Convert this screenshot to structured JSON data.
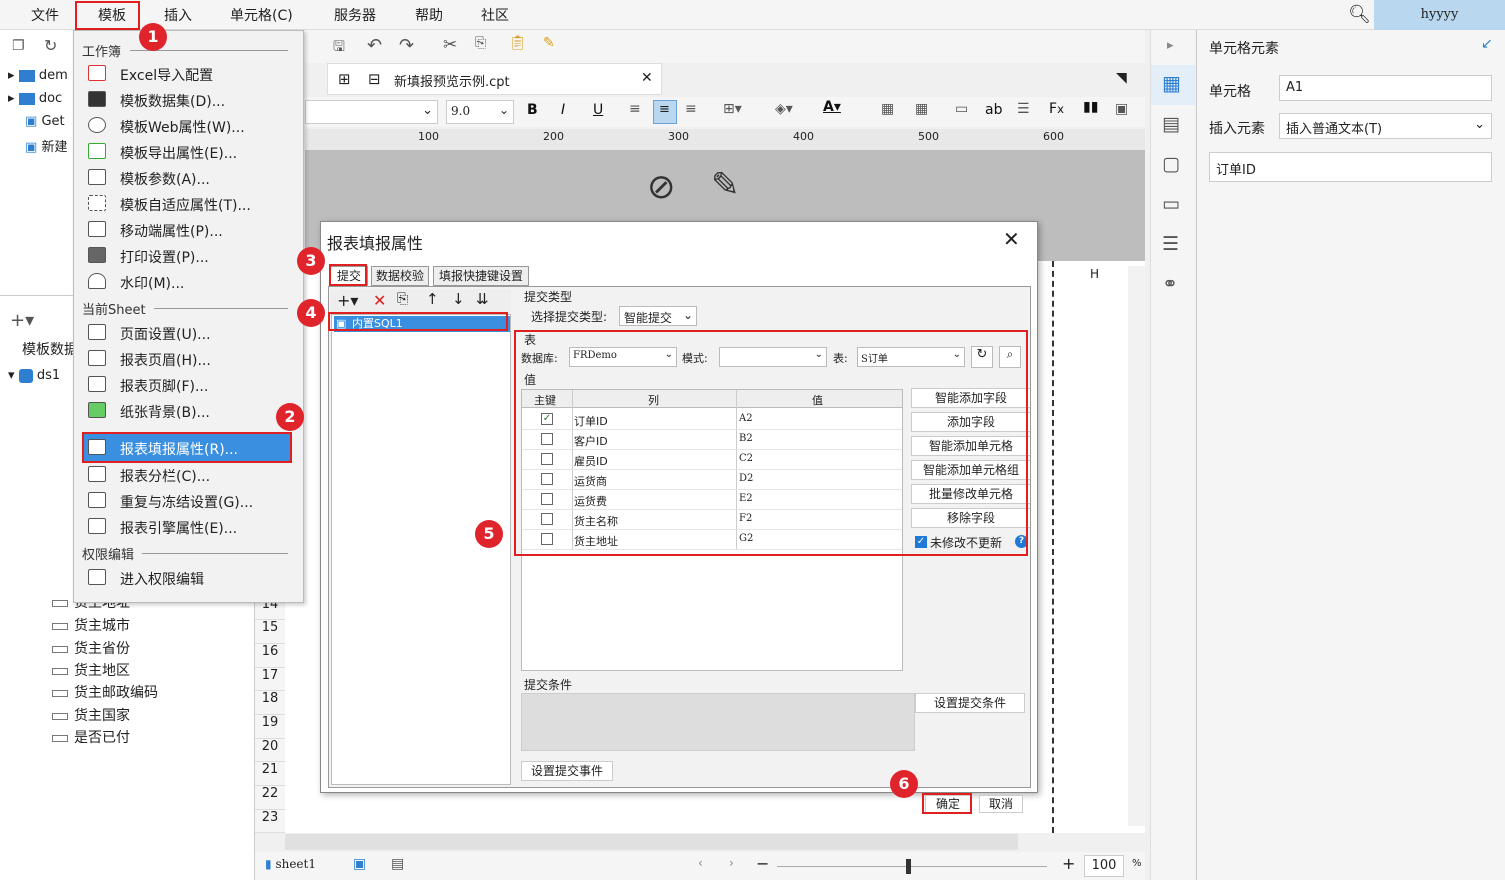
{
  "menubar": {
    "items": [
      "文件",
      "模板",
      "插入",
      "单元格(C)",
      "服务器",
      "帮助",
      "社区"
    ],
    "user": "hyyyy"
  },
  "left_panel": {
    "tree": [
      "dem",
      "doc",
      "Get",
      "新建"
    ],
    "dataset_header": "模板数据",
    "dataset_name": "ds1",
    "fields": [
      "货主地址",
      "货主城市",
      "货主省份",
      "货主地区",
      "货主邮政编码",
      "货主国家",
      "是否已付"
    ]
  },
  "template_menu": {
    "section_workbook": "工作簿",
    "workbook_items": [
      "Excel导入配置",
      "模板数据集(D)...",
      "模板Web属性(W)...",
      "模板导出属性(E)...",
      "模板参数(A)...",
      "模板自适应属性(T)...",
      "移动端属性(P)...",
      "打印设置(P)...",
      "水印(M)..."
    ],
    "section_sheet": "当前Sheet",
    "sheet_items": [
      "页面设置(U)...",
      "报表页眉(H)...",
      "报表页脚(F)...",
      "纸张背景(B)...",
      "报表填报属性(R)...",
      "报表分栏(C)...",
      "重复与冻结设置(G)...",
      "报表引擎属性(E)..."
    ],
    "section_perm": "权限编辑",
    "perm_items": [
      "进入权限编辑"
    ]
  },
  "editor": {
    "tab_name": "新填报预览示例.cpt",
    "font_size": "9.0",
    "ruler_marks": [
      "100",
      "200",
      "300",
      "400",
      "500",
      "600"
    ],
    "col_h": "H",
    "row_numbers": [
      "14",
      "15",
      "16",
      "17",
      "18",
      "19",
      "20",
      "21",
      "22",
      "23"
    ],
    "sheet_tab": "sheet1",
    "zoom": "100",
    "zoom_unit": "%"
  },
  "right_panel": {
    "title": "单元格元素",
    "cell_label": "单元格",
    "cell_value": "A1",
    "insert_label": "插入元素",
    "insert_value": "插入普通文本(T)",
    "content": "订单ID"
  },
  "dialog": {
    "title": "报表填报属性",
    "tabs": [
      "提交",
      "数据校验",
      "填报快捷键设置"
    ],
    "list_item": "内置SQL1",
    "submit_type_group": "提交类型",
    "submit_type_label": "选择提交类型:",
    "submit_type_value": "智能提交",
    "table_group": "表",
    "db_label": "数据库:",
    "db_value": "FRDemo",
    "schema_label": "模式:",
    "schema_value": "",
    "table_label": "表:",
    "table_value": "S订单",
    "values_group": "值",
    "col_headers": [
      "主键",
      "列",
      "值"
    ],
    "rows": [
      {
        "key": true,
        "col": "订单ID",
        "val": "A2"
      },
      {
        "key": false,
        "col": "客户ID",
        "val": "B2"
      },
      {
        "key": false,
        "col": "雇员ID",
        "val": "C2"
      },
      {
        "key": false,
        "col": "运货商",
        "val": "D2"
      },
      {
        "key": false,
        "col": "运货费",
        "val": "E2"
      },
      {
        "key": false,
        "col": "货主名称",
        "val": "F2"
      },
      {
        "key": false,
        "col": "货主地址",
        "val": "G2"
      }
    ],
    "side_buttons": [
      "智能添加字段",
      "添加字段",
      "智能添加单元格",
      "智能添加单元格组",
      "批量修改单元格",
      "移除字段"
    ],
    "unchanged_label": "未修改不更新",
    "condition_group": "提交条件",
    "condition_button": "设置提交条件",
    "event_button": "设置提交事件",
    "ok": "确定",
    "cancel": "取消"
  },
  "badges": [
    "1",
    "2",
    "3",
    "4",
    "5",
    "6"
  ],
  "colors": {
    "accent": "#1e7ad6",
    "highlight": "#e02020",
    "selection": "#3b8fe0"
  }
}
